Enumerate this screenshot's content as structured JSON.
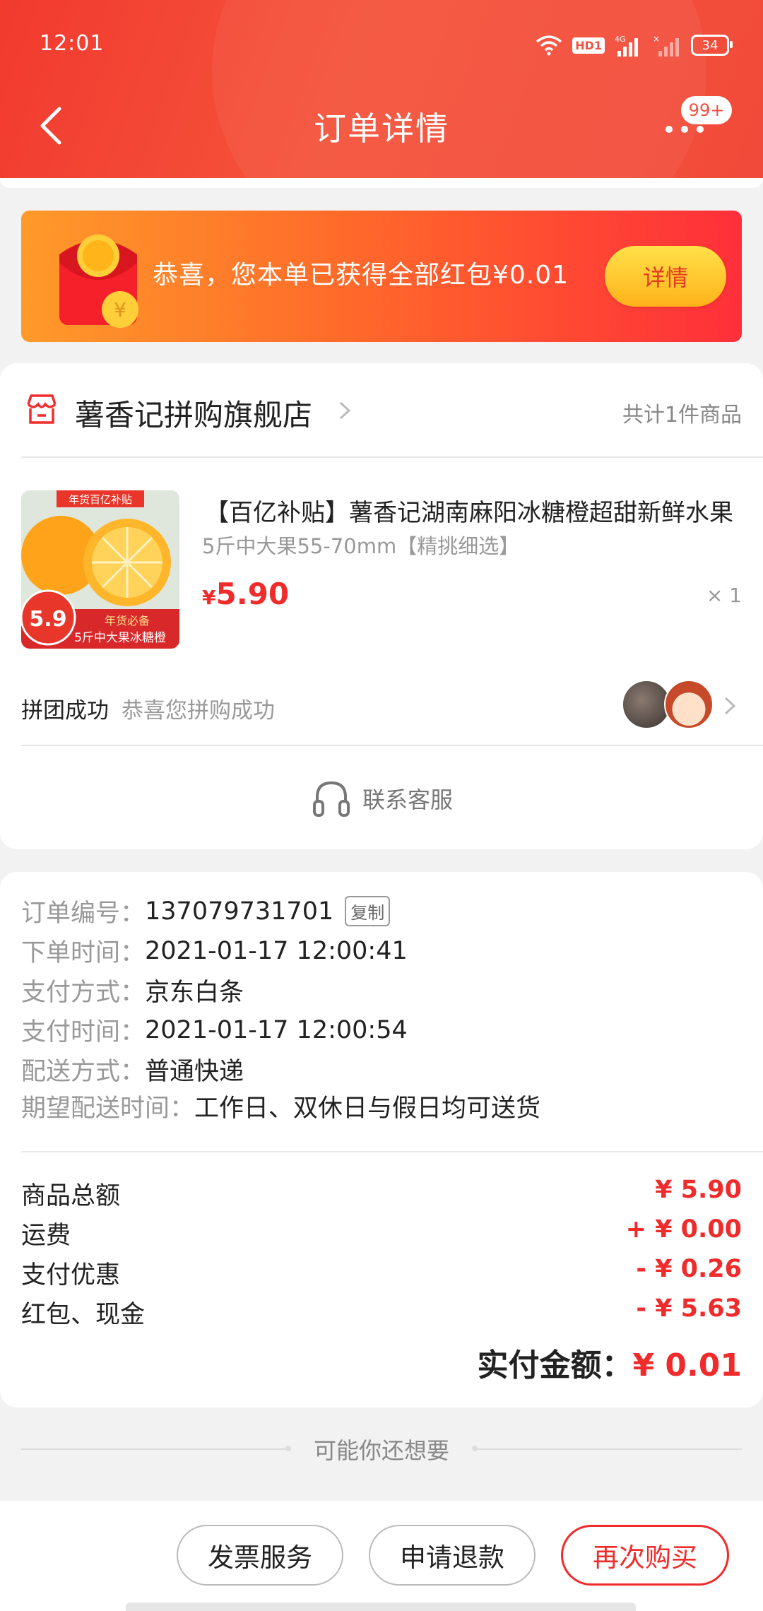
{
  "status_bar": {
    "time": "12:01",
    "hd_label": "HD1",
    "network": "4G",
    "battery": "34"
  },
  "header": {
    "title": "订单详情",
    "message_badge": "99+"
  },
  "banner": {
    "text": "恭喜，您本单已获得全部红包¥0.01",
    "button_label": "详情"
  },
  "shop": {
    "name": "薯香记拼购旗舰店",
    "item_count": "共计1件商品"
  },
  "product": {
    "title": "【百亿补贴】薯香记湖南麻阳冰糖橙超甜新鲜水果",
    "sku": "5斤中大果55-70mm【精挑细选】",
    "price_symbol": "¥",
    "price": "5.90",
    "quantity": "× 1",
    "image_tag": "年货百亿补贴",
    "image_price": "5.9",
    "image_sub": "年货必备",
    "image_caption": "5斤中大果冰糖橙"
  },
  "group": {
    "label": "拼团成功",
    "sub": "恭喜您拼购成功"
  },
  "service": {
    "label": "联系客服"
  },
  "order_info": [
    {
      "label": "订单编号：",
      "value": "137079731701"
    },
    {
      "label": "下单时间：",
      "value": "2021-01-17 12:00:41"
    },
    {
      "label": "支付方式：",
      "value": "京东白条"
    },
    {
      "label": "支付时间：",
      "value": "2021-01-17 12:00:54"
    },
    {
      "label": "配送方式：",
      "value": "普通快递"
    },
    {
      "label": "期望配送时间：",
      "value": "工作日、双休日与假日均可送货"
    }
  ],
  "copy_label": "复制",
  "costs": [
    {
      "label": "商品总额",
      "value": "¥ 5.90"
    },
    {
      "label": "运费",
      "value": "+ ¥ 0.00"
    },
    {
      "label": "支付优惠",
      "value": "- ¥ 0.26"
    },
    {
      "label": "红包、现金",
      "value": "- ¥ 5.63"
    }
  ],
  "total": {
    "label": "实付金额：",
    "value": "¥ 0.01"
  },
  "recommend_label": "可能你还想要",
  "actions": {
    "invoice": "发票服务",
    "refund": "申请退款",
    "rebuy": "再次购买"
  },
  "colors": {
    "brand_red": "#f24a3a",
    "price_red": "#f02b2b",
    "banner_start": "#ff9a2a",
    "banner_end": "#ff2f3a",
    "button_yellow": "#ffc82a"
  }
}
